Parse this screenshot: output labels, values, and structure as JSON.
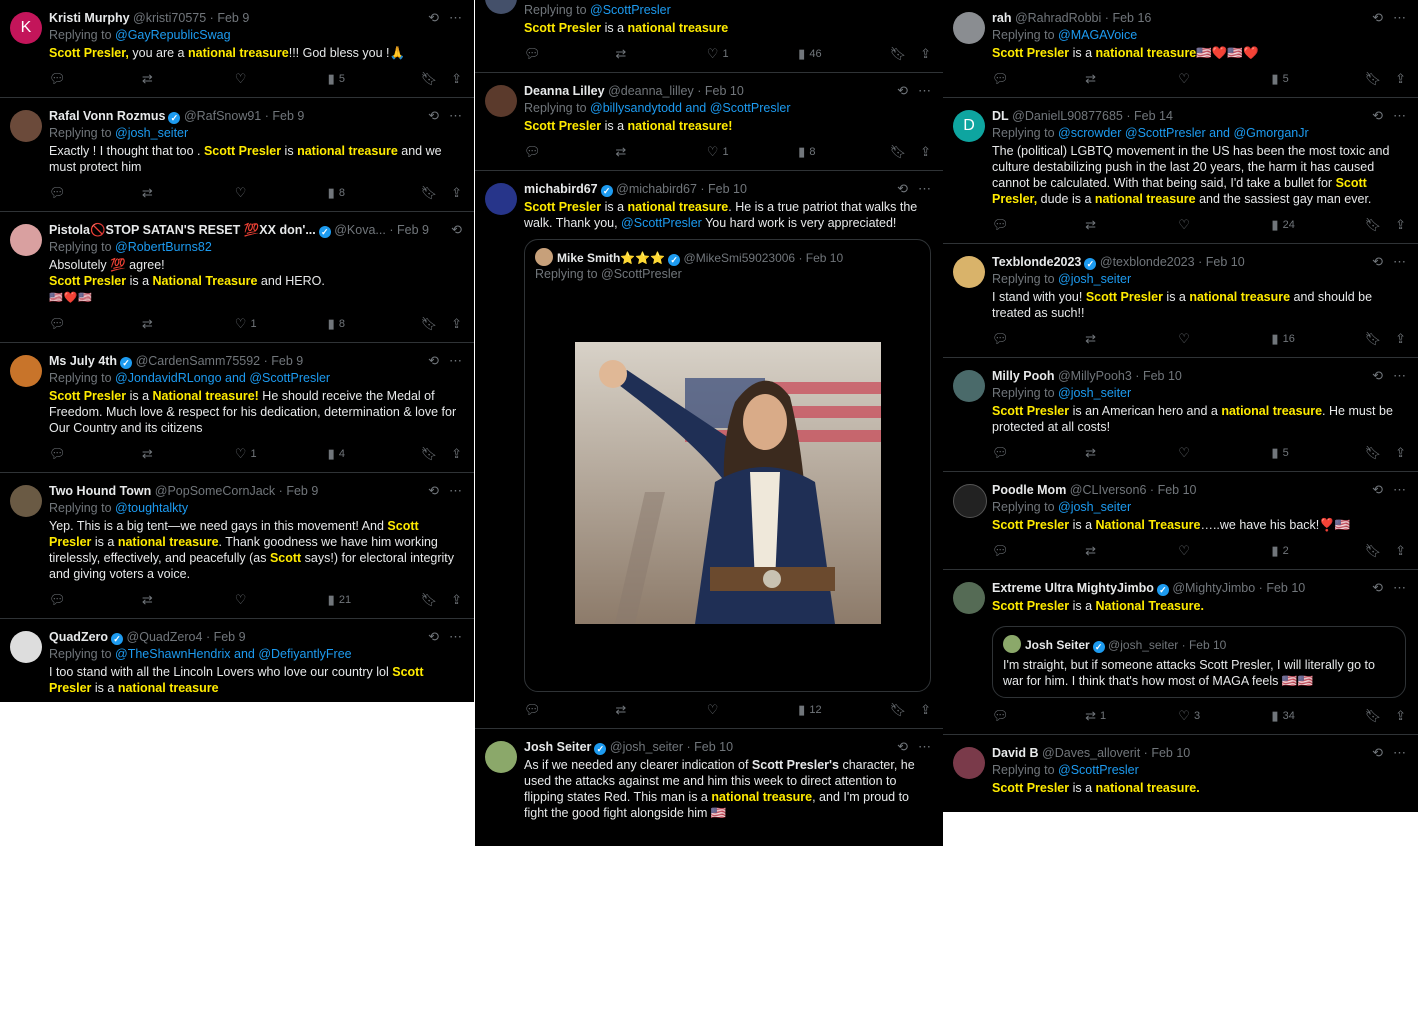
{
  "col1": [
    {
      "name": "Kristi Murphy",
      "verified": false,
      "handle": "@kristi70575",
      "date": "Feb 9",
      "reply_to": "@GayRepublicSwag",
      "text": [
        "Scott Presler,",
        " you are a ",
        "national treasure",
        "!!! God bless you !🙏"
      ],
      "reply": "",
      "repost": "",
      "like": "",
      "views": "5",
      "avatar_letter": "K",
      "avatar_color": "#c3155a"
    },
    {
      "name": "Rafal Vonn Rozmus",
      "verified": true,
      "handle": "@RafSnow91",
      "date": "Feb 9",
      "reply_to": "@josh_seiter",
      "text": [
        "Exactly ! I thought that too . ",
        "Scott Presler",
        " is ",
        "national treasure",
        " and we must protect him"
      ],
      "reply": "",
      "repost": "",
      "like": "",
      "views": "8",
      "avatar_color": "#6b4a3a"
    },
    {
      "name": "Pistola🚫STOP SATAN'S RESET 💯XX don'...",
      "verified": true,
      "handle": "@Kova...",
      "date": "Feb 9",
      "reply_to": "@RobertBurns82",
      "text": [
        "Absolutely 💯 agree! ",
        "Scott Presler",
        " is a ",
        "National Treasure",
        " and HERO."
      ],
      "flags": "🇺🇸❤️🇺🇸",
      "reply": "",
      "repost": "",
      "like": "1",
      "views": "8",
      "avatar_color": "#d9a0a0"
    },
    {
      "name": "Ms July 4th",
      "verified": true,
      "handle": "@CardenSamm75592",
      "date": "Feb 9",
      "reply_to": "@JondavidRLongo and @ScottPresler",
      "text": [
        "Scott Presler",
        " is a ",
        "National treasure!",
        " He should receive the Medal of Freedom. Much love & respect for his dedication, determination & love for Our Country and its citizens"
      ],
      "reply": "",
      "repost": "",
      "like": "1",
      "views": "4",
      "avatar_color": "#c8742a"
    },
    {
      "name": "Two Hound Town",
      "verified": false,
      "handle": "@PopSomeCornJack",
      "date": "Feb 9",
      "reply_to": "@toughtalkty",
      "text": [
        "Yep. This is a big tent—we need gays in this movement! And ",
        "Scott Presler",
        " is a ",
        "national treasure",
        ". Thank goodness we have him working tirelessly, effectively, and peacefully (as ",
        "Scott",
        " says!) for electoral integrity and giving voters a voice."
      ],
      "reply": "",
      "repost": "",
      "like": "",
      "views": "21",
      "avatar_color": "#6a5a44"
    },
    {
      "name": "QuadZero",
      "verified": true,
      "handle": "@QuadZero4",
      "date": "Feb 9",
      "reply_to": "@TheShawnHendrix and @DefiyantlyFree",
      "text": [
        "I too stand with all the Lincoln Lovers who love our country lol ",
        "Scott Presler",
        " is a ",
        "national treasure"
      ],
      "avatar_color": "#dddddd"
    }
  ],
  "col2_top": {
    "reply_to": "@ScottPresler",
    "text": [
      "Scott Presler",
      " is a ",
      "national treasure"
    ],
    "like": "1",
    "views": "46"
  },
  "col2": [
    {
      "name": "Deanna Lilley",
      "verified": false,
      "handle": "@deanna_lilley",
      "date": "Feb 10",
      "reply_to": "@billysandytodd and @ScottPresler",
      "text": [
        "Scott Presler",
        " is a ",
        "national treasure!"
      ],
      "like": "1",
      "views": "8",
      "avatar_color": "#5b3a2c"
    },
    {
      "name": "michabird67",
      "verified": true,
      "handle": "@michabird67",
      "date": "Feb 10",
      "text": [
        "Scott Presler",
        " is a ",
        "national treasure",
        ".",
        " He is a true patriot that walks the walk.  Thank you, ",
        "@ScottPresler",
        " You hard work is very appreciated!"
      ],
      "quote": {
        "name": "Mike Smith",
        "stars": "⭐⭐⭐",
        "handle": "@MikeSmi59023006",
        "date": "Feb 10",
        "reply_to": "Replying to @ScottPresler"
      },
      "like": "",
      "views": "12",
      "avatar_color": "#27358a"
    },
    {
      "name": "Josh Seiter",
      "verified": true,
      "handle": "@josh_seiter",
      "date": "Feb 10",
      "text": [
        "As if we needed any clearer indication of ",
        "Scott Presler's",
        " character, he used the attacks against me and him this week to direct attention to flipping states Red. This man is a ",
        "national treasure",
        ", and I'm proud to fight the good fight alongside him 🇺🇸"
      ],
      "avatar_color": "#8ba86a"
    }
  ],
  "col3": [
    {
      "name": "rah",
      "verified": false,
      "handle": "@RahradRobbi",
      "date": "Feb 16",
      "reply_to": "@MAGAVoice",
      "text": [
        "Scott Presler",
        " is a ",
        "national treasure",
        "🇺🇸❤️🇺🇸❤️"
      ],
      "like": "",
      "views": "5",
      "avatar_color": "#8a8d91"
    },
    {
      "name": "DL",
      "verified": false,
      "handle": "@DanielL90877685",
      "date": "Feb 14",
      "reply_to": "@scrowder @ScottPresler and @GmorganJr",
      "text": [
        "The (political) LGBTQ movement in the US has been the most toxic and culture destabilizing push in the last 20 years, the harm it has caused cannot be calculated. With that being said, I'd take a bullet for ",
        "Scott Presler,",
        " dude is a ",
        "national treasure",
        " and the sassiest gay man ever."
      ],
      "like": "",
      "views": "24",
      "avatar_letter": "D",
      "avatar_color": "#0ea5a0"
    },
    {
      "name": "Texblonde2023",
      "verified": true,
      "handle": "@texblonde2023",
      "date": "Feb 10",
      "reply_to": "@josh_seiter",
      "text": [
        "I stand with you!  ",
        "Scott Presler",
        " is a ",
        "national treasure",
        " and should be treated as such!!"
      ],
      "like": "",
      "views": "16",
      "avatar_color": "#d9b36a"
    },
    {
      "name": "Milly Pooh",
      "verified": false,
      "handle": "@MillyPooh3",
      "date": "Feb 10",
      "reply_to": "@josh_seiter",
      "text": [
        "Scott Presler",
        " is an American hero and a ",
        "national treasure",
        ". He must be protected at all costs!"
      ],
      "like": "",
      "views": "5",
      "avatar_color": "#4a6a6a"
    },
    {
      "name": "Poodle Mom",
      "verified": false,
      "handle": "@CLIverson6",
      "date": "Feb 10",
      "reply_to": "@josh_seiter",
      "text": [
        "Scott Presler",
        " is a ",
        "National Treasure",
        "…..we have his back!❣️🇺🇸"
      ],
      "like": "",
      "views": "2",
      "avatar_color": "#222222"
    },
    {
      "name": "Extreme Ultra MightyJimbo",
      "verified": true,
      "handle": "@MightyJimbo",
      "date": "Feb 10",
      "text": [
        "Scott Presler",
        " is a ",
        "National Treasure",
        "."
      ],
      "quote": {
        "name": "Josh Seiter",
        "handle": "@josh_seiter",
        "date": "Feb 10",
        "text": "I'm straight, but if someone attacks Scott Presler, I will literally go to war for him. I think that's how most of MAGA feels 🇺🇸🇺🇸"
      },
      "repost": "1",
      "like": "3",
      "views": "34",
      "avatar_color": "#556b55"
    },
    {
      "name": "David B",
      "verified": false,
      "handle": "@Daves_alloverit",
      "date": "Feb 10",
      "reply_to": "@ScottPresler",
      "text": [
        "Scott Presler",
        " is a ",
        "national treasure",
        "."
      ],
      "avatar_color": "#7a3a4a"
    }
  ],
  "labels": {
    "replying": "Replying to "
  },
  "colors": {
    "background": "#000000",
    "highlight": "#ffeb00",
    "link": "#1d9bf0",
    "muted": "#71767b"
  }
}
